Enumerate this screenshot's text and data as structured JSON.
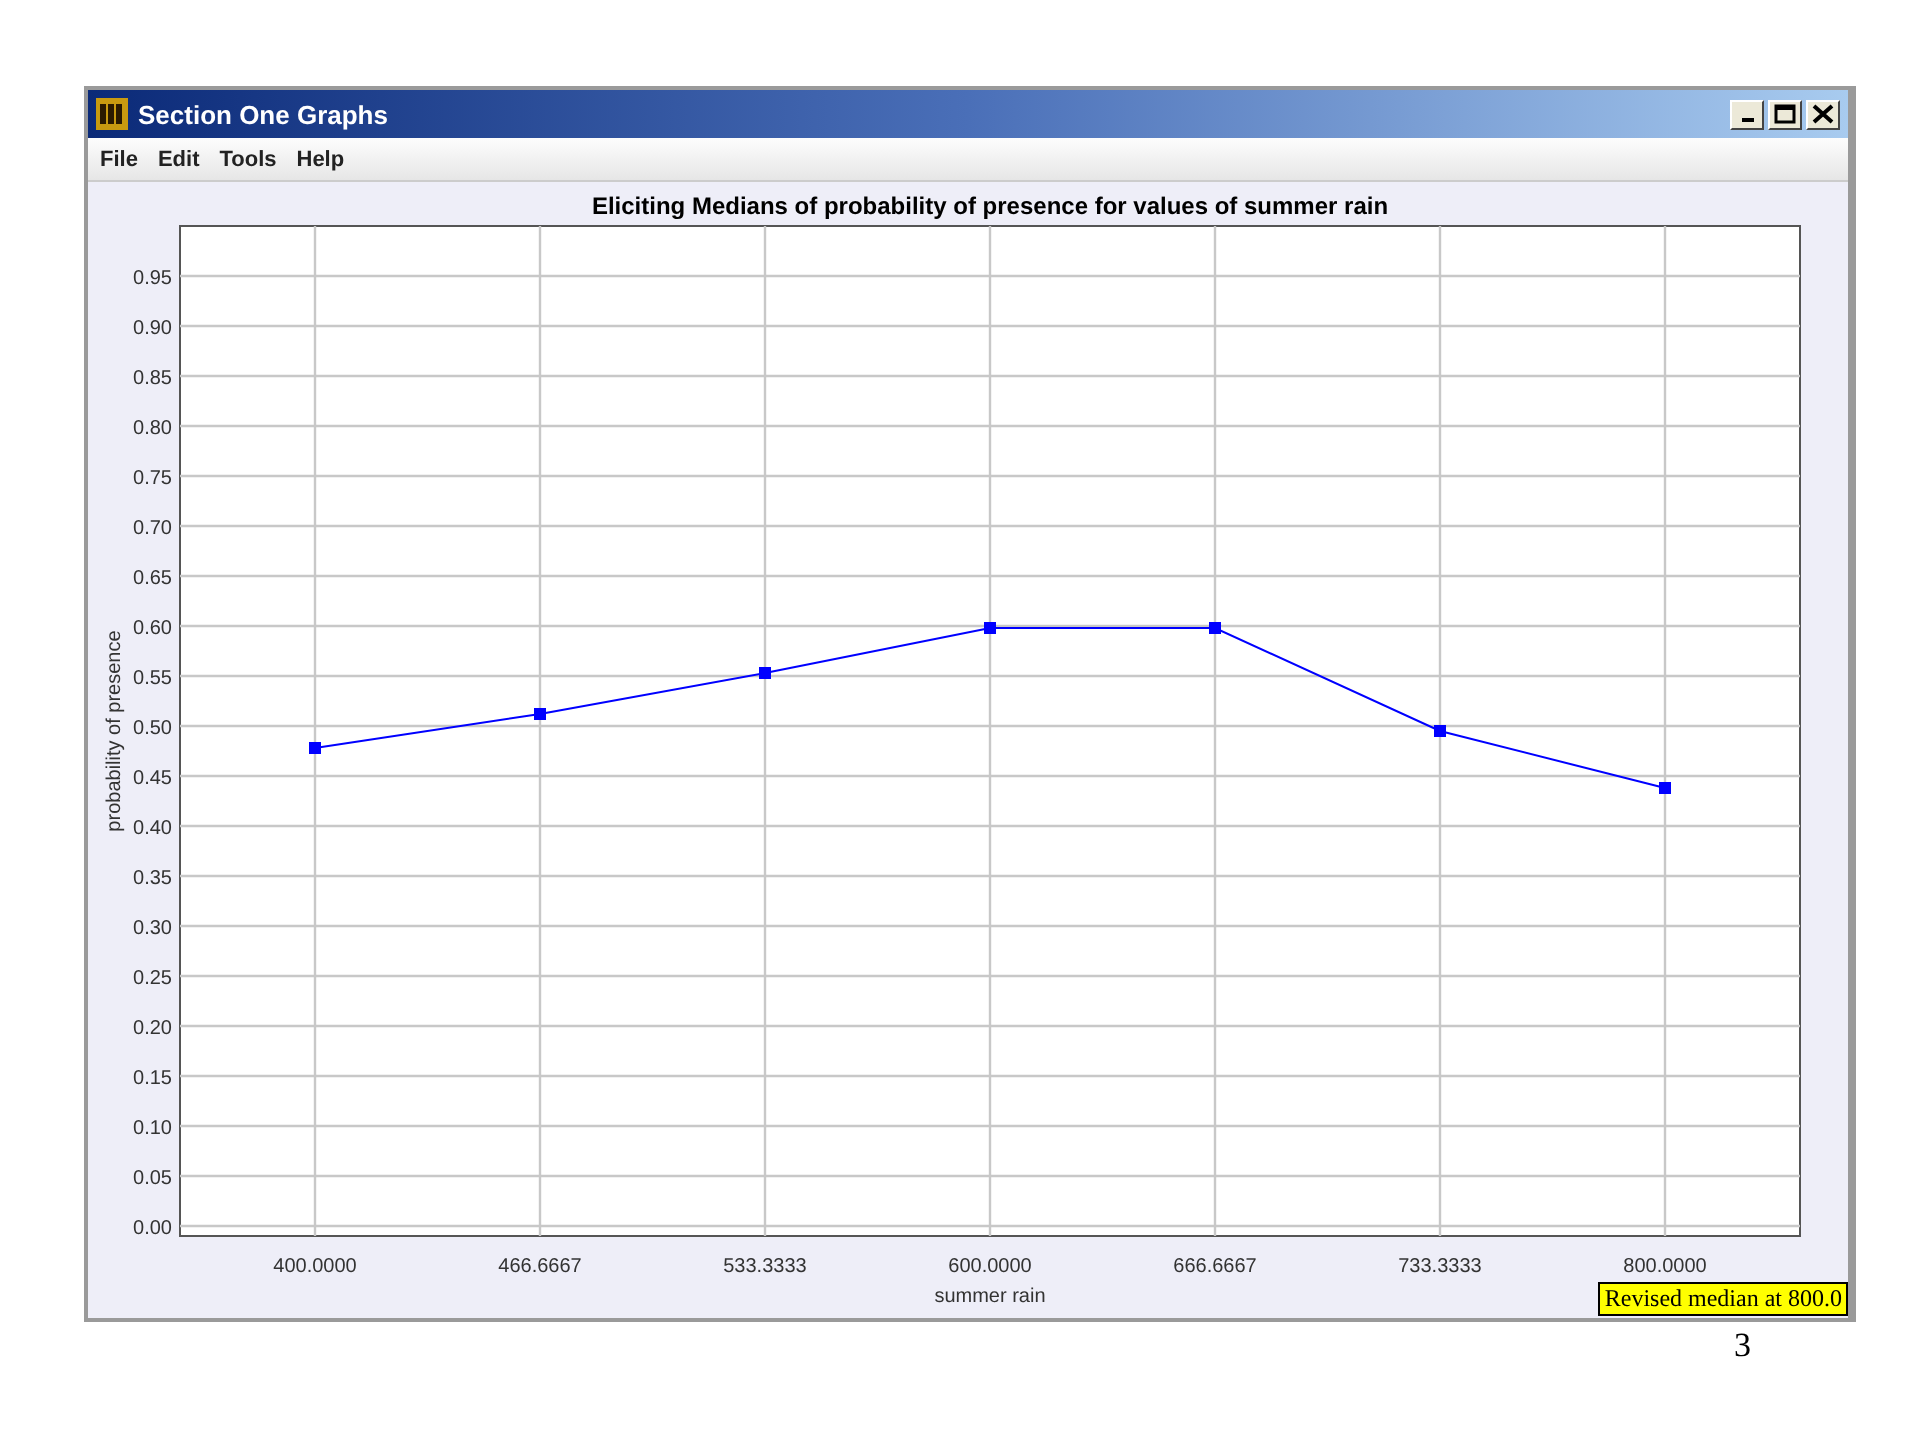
{
  "window": {
    "title": "Section One Graphs"
  },
  "menu": [
    {
      "label": "File"
    },
    {
      "label": "Edit"
    },
    {
      "label": "Tools"
    },
    {
      "label": "Help"
    }
  ],
  "graph": {
    "chart_data": {
      "type": "line",
      "title": "Eliciting Medians of probability of presence for values of summer rain",
      "xlabel": "summer rain",
      "ylabel": "probability of presence",
      "x": [
        400,
        466.6667,
        533.3333,
        600,
        666.6667,
        733.3333,
        800
      ],
      "grid": true,
      "series": [
        {
          "color": "#0000ff",
          "marker": "square",
          "values": [
            0.478,
            0.512,
            0.553,
            0.598,
            0.598,
            0.495,
            0.438
          ]
        }
      ],
      "xlim": [
        360,
        840
      ],
      "ylim": [
        -0.01,
        1.0
      ],
      "xticks": [
        {
          "value": 400,
          "label": "400.0000"
        },
        {
          "value": 466.6667,
          "label": "466.6667"
        },
        {
          "value": 533.3333,
          "label": "533.3333"
        },
        {
          "value": 600,
          "label": "600.0000"
        },
        {
          "value": 666.6667,
          "label": "666.6667"
        },
        {
          "value": 733.3333,
          "label": "733.3333"
        },
        {
          "value": 800,
          "label": "800.0000"
        }
      ],
      "yticks": [
        {
          "value": 0,
          "label": "0.00"
        },
        {
          "value": 0.05,
          "label": "0.05"
        },
        {
          "value": 0.1,
          "label": "0.10"
        },
        {
          "value": 0.15,
          "label": "0.15"
        },
        {
          "value": 0.2,
          "label": "0.20"
        },
        {
          "value": 0.25,
          "label": "0.25"
        },
        {
          "value": 0.3,
          "label": "0.30"
        },
        {
          "value": 0.35,
          "label": "0.35"
        },
        {
          "value": 0.4,
          "label": "0.40"
        },
        {
          "value": 0.45,
          "label": "0.45"
        },
        {
          "value": 0.5,
          "label": "0.50"
        },
        {
          "value": 0.55,
          "label": "0.55"
        },
        {
          "value": 0.6,
          "label": "0.60"
        },
        {
          "value": 0.65,
          "label": "0.65"
        },
        {
          "value": 0.7,
          "label": "0.70"
        },
        {
          "value": 0.75,
          "label": "0.75"
        },
        {
          "value": 0.8,
          "label": "0.80"
        },
        {
          "value": 0.85,
          "label": "0.85"
        },
        {
          "value": 0.9,
          "label": "0.90"
        },
        {
          "value": 0.95,
          "label": "0.95"
        }
      ]
    },
    "tooltip": "Revised median at 800.0"
  },
  "slide_number": "3"
}
